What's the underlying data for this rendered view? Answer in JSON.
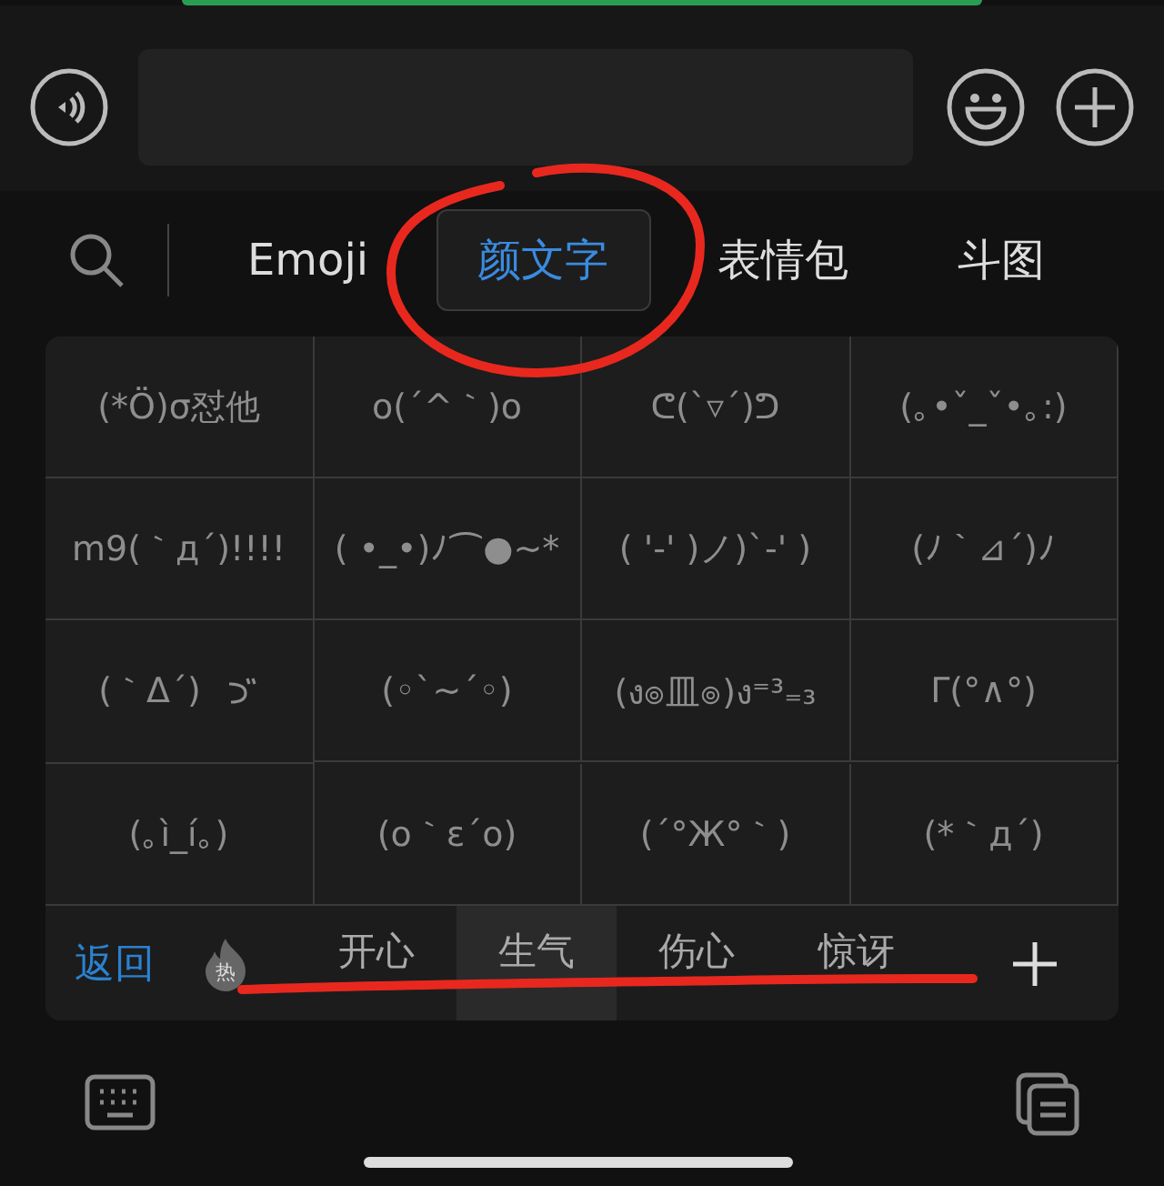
{
  "tabs": [
    {
      "label": "Emoji",
      "selected": false
    },
    {
      "label": "颜文字",
      "selected": true
    },
    {
      "label": "表情包",
      "selected": false
    },
    {
      "label": "斗图",
      "selected": false
    }
  ],
  "kaomoji": [
    [
      "(*Ö)σ怼他",
      "o(´^｀)o",
      "ᕦ(`▿´)ᕤ",
      "(｡•ˇ_ˇ•｡:)"
    ],
    [
      "m9(｀д´)!!!!",
      "( •_•)ﾉ⌒●~*",
      "( '-' )ノ)`-' )",
      "(ﾉ｀⊿´)ﾉ"
    ],
    [
      {
        "text": "(｀Δ´)",
        "kind": "wave-mark"
      },
      "(◦`~´◦)",
      "(ง๏皿๏)ง⁼³₌₃",
      "Γ(°∧°)"
    ],
    [
      "(｡ì_í｡)",
      "(o｀ε´o)",
      "(´°Ж°｀)",
      "(*｀д´)"
    ]
  ],
  "back_label": "返回",
  "hot_badge": "热",
  "categories": [
    {
      "label": "开心",
      "selected": false
    },
    {
      "label": "生气",
      "selected": true
    },
    {
      "label": "伤心",
      "selected": false
    },
    {
      "label": "惊讶",
      "selected": false
    }
  ]
}
